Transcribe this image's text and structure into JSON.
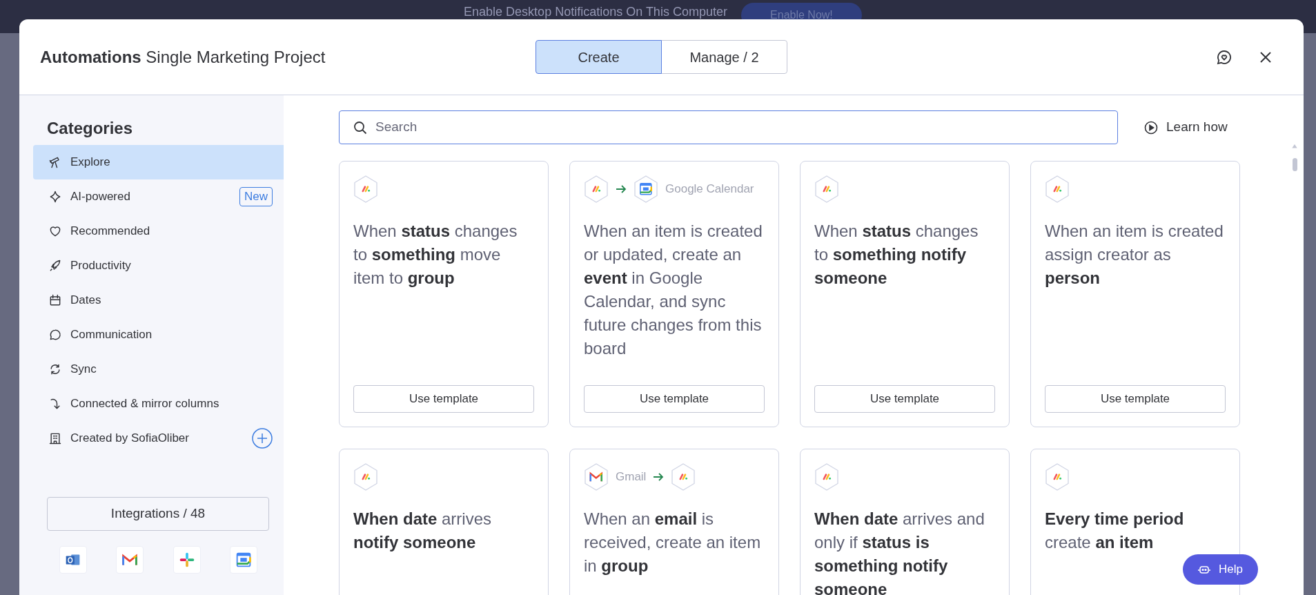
{
  "notification_bar": {
    "text": "Enable Desktop Notifications On This Computer",
    "button": "Enable Now!"
  },
  "header": {
    "title": "Automations",
    "subtitle": "Single Marketing Project",
    "tabs": [
      {
        "label": "Create",
        "selected": true
      },
      {
        "label": "Manage / 2",
        "selected": false
      }
    ]
  },
  "sidebar": {
    "title": "Categories",
    "items": [
      {
        "label": "Explore",
        "selected": true
      },
      {
        "label": "AI-powered",
        "selected": false,
        "badge": "New"
      },
      {
        "label": "Recommended",
        "selected": false
      },
      {
        "label": "Productivity",
        "selected": false
      },
      {
        "label": "Dates",
        "selected": false
      },
      {
        "label": "Communication",
        "selected": false
      },
      {
        "label": "Sync",
        "selected": false
      },
      {
        "label": "Connected & mirror columns",
        "selected": false
      },
      {
        "label": "Created by SofiaOliber",
        "selected": false,
        "add_button": true
      }
    ],
    "integrations_button": "Integrations / 48"
  },
  "search": {
    "placeholder": "Search"
  },
  "learn_how": "Learn how",
  "templates": [
    {
      "header": [
        {
          "kind": "monday"
        }
      ],
      "text": "When **status** changes to **something** move item to **group**",
      "button": "Use template"
    },
    {
      "header": [
        {
          "kind": "monday"
        },
        {
          "kind": "arrow"
        },
        {
          "kind": "calendar"
        },
        {
          "kind": "label",
          "text": "Google Calendar"
        }
      ],
      "text": "When an item is created or updated, create an **event** in Google Calendar, and sync future changes from this board",
      "button": "Use template"
    },
    {
      "header": [
        {
          "kind": "monday"
        }
      ],
      "text": "When **status** changes to **something notify someone**",
      "button": "Use template"
    },
    {
      "header": [
        {
          "kind": "monday"
        }
      ],
      "text": "When an item is created assign creator as **person**",
      "button": "Use template"
    },
    {
      "header": [
        {
          "kind": "monday"
        }
      ],
      "text": "**When date** arrives **notify someone**"
    },
    {
      "header": [
        {
          "kind": "mail"
        },
        {
          "kind": "label",
          "text": "Gmail"
        },
        {
          "kind": "arrow"
        },
        {
          "kind": "monday"
        }
      ],
      "text": "When an **email** is received, create an item in **group**"
    },
    {
      "header": [
        {
          "kind": "monday"
        }
      ],
      "text": "**When date** arrives and only if **status is something notify someone**"
    },
    {
      "header": [
        {
          "kind": "monday"
        }
      ],
      "text": "**Every time period** create **an item**"
    }
  ],
  "help_button": "Help"
}
